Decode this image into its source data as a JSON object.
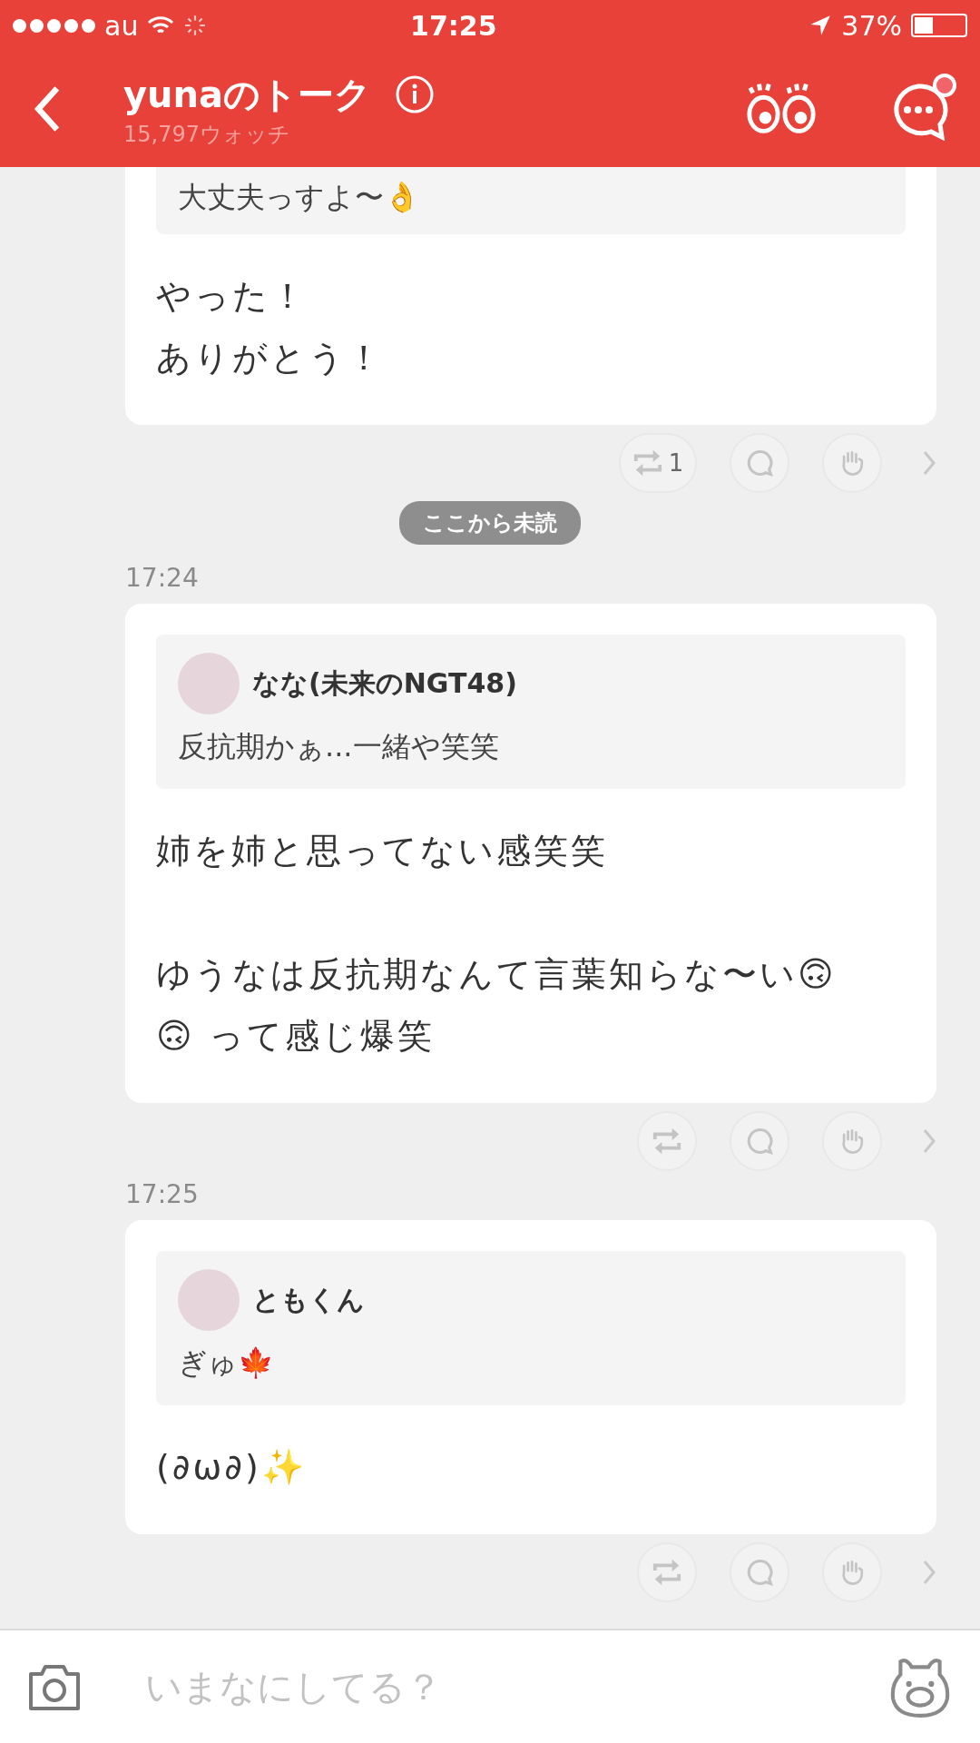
{
  "status_bar": {
    "carrier": "au",
    "time": "17:25",
    "battery": "37%"
  },
  "header": {
    "title": "yunaのトーク",
    "subtitle": "15,797ウォッチ",
    "has_notification": true
  },
  "posts": [
    {
      "quote": {
        "text": "大丈夫っすよ〜👌"
      },
      "paragraphs": [
        [
          "やった！",
          "ありがとう！"
        ]
      ],
      "repost_count": "1",
      "divider_after": "ここから未読"
    },
    {
      "time": "17:24",
      "quote": {
        "author": "なな(未来のNGT48)",
        "text": "反抗期かぁ...一緒や笑笑"
      },
      "paragraphs": [
        [
          "姉を姉と思ってない感笑笑"
        ],
        [
          "ゆうなは反抗期なんて言葉知らな〜い🙃🙃 って感じ爆笑"
        ]
      ]
    },
    {
      "time": "17:25",
      "quote": {
        "author": "ともくん",
        "text": "ぎゅ🍁"
      },
      "paragraphs": [
        [
          "(∂ω∂)✨"
        ]
      ]
    }
  ],
  "composer": {
    "placeholder": "いまなにしてる？"
  }
}
